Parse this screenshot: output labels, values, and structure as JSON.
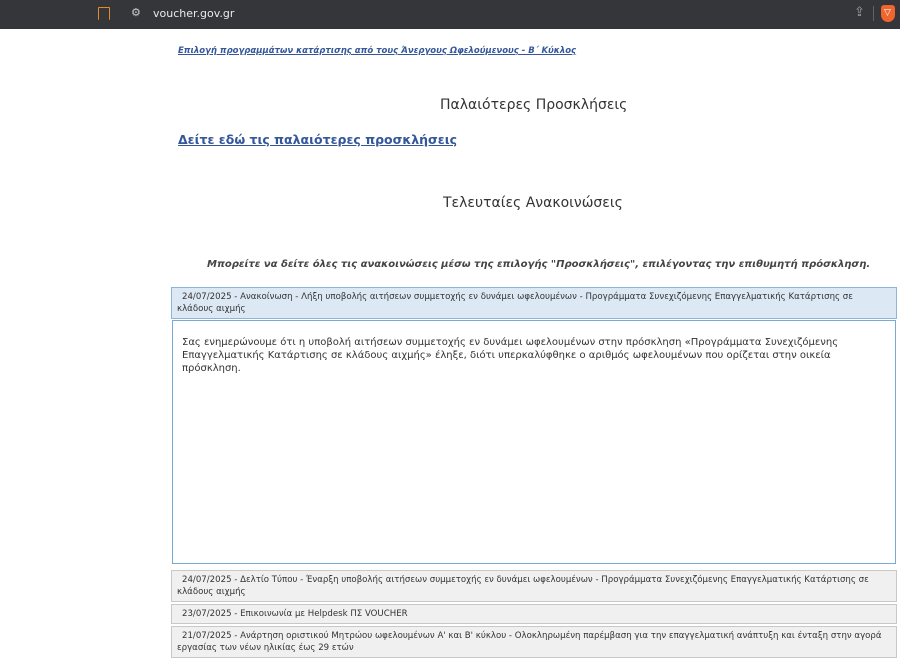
{
  "browser": {
    "url": "voucher.gov.gr",
    "icons": [
      "bookmark-icon",
      "site-settings-icon",
      "share-icon",
      "brave-shield-icon"
    ],
    "accent": "#e58a2a"
  },
  "page": {
    "top_link": "Επιλογή προγραμμάτων κατάρτισης από τους Άνεργους Ωφελούμενους - Β΄ Κύκλος",
    "old_calls_heading": "Παλαιότερες Προσκλήσεις",
    "old_calls_link": "Δείτε εδώ τις παλαιότερες προσκλήσεις",
    "latest_heading": "Τελευταίες Ανακοινώσεις",
    "note": "Μπορείτε να δείτε όλες τις ανακοινώσεις μέσω της επιλογής \"Προσκλήσεις\", επιλέγοντας την επιθυμητή πρόσκληση."
  },
  "announcements": [
    {
      "date": "24/07/2025",
      "title": " - Ανακοίνωση - Λήξη υποβολής αιτήσεων συμμετοχής εν δυνάμει ωφελουμένων - Προγράμματα Συνεχιζόμενης Επαγγελματικής Κατάρτισης σε κλάδους αιχμής",
      "expanded": true,
      "body": "Σας ενημερώνουμε ότι η υποβολή αιτήσεων συμμετοχής εν δυνάμει ωφελουμένων στην πρόσκληση «Προγράμματα Συνεχιζόμενης Επαγγελματικής Κατάρτισης σε κλάδους αιχμής» έληξε, διότι υπερκαλύφθηκε ο αριθμός ωφελουμένων που ορίζεται στην οικεία πρόσκληση."
    },
    {
      "date": "24/07/2025",
      "title": " - Δελτίο Τύπου - Έναρξη υποβολής αιτήσεων συμμετοχής εν δυνάμει ωφελουμένων - Προγράμματα Συνεχιζόμενης Επαγγελματικής Κατάρτισης σε κλάδους αιχμής",
      "expanded": false
    },
    {
      "date": "23/07/2025",
      "title": " - Επικοινωνία με Helpdesk ΠΣ VOUCHER",
      "expanded": false
    },
    {
      "date": "21/07/2025",
      "title": " - Ανάρτηση οριστικού Μητρώου ωφελουμένων Α' και Β' κύκλου - Ολοκληρωμένη παρέμβαση για την επαγγελματική ανάπτυξη και ένταξη στην αγορά εργασίας των νέων ηλικίας έως 29 ετών",
      "expanded": false
    }
  ]
}
